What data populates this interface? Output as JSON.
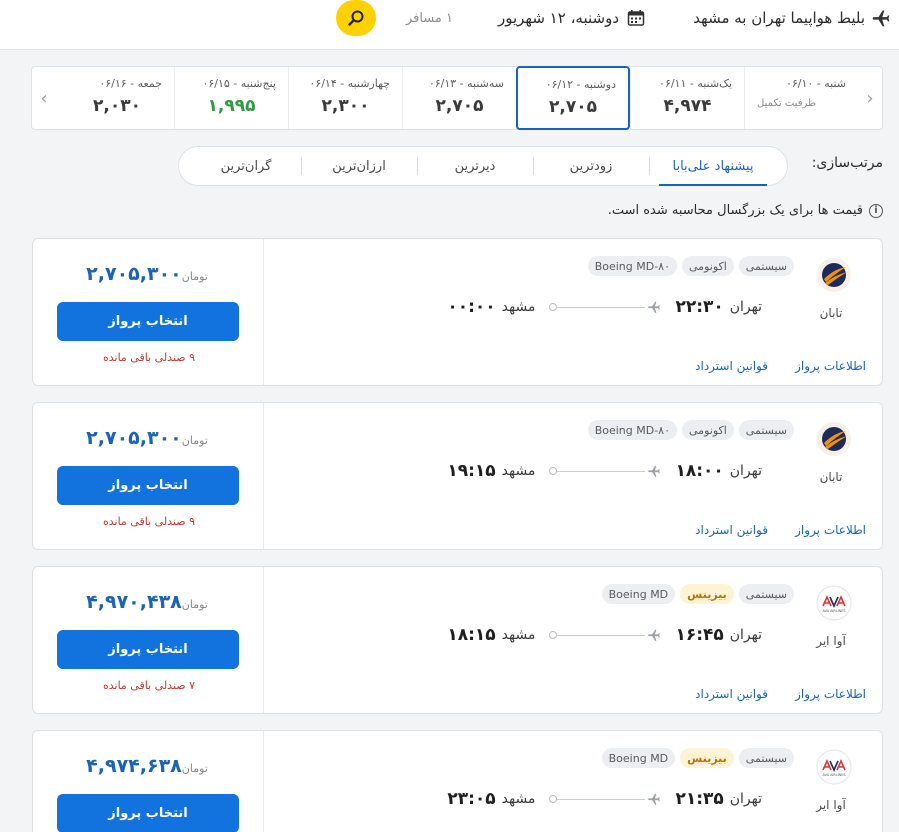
{
  "header": {
    "title": "بلیط هواپیما تهران به مشهد",
    "date": "دوشنبه، ۱۲ شهریور",
    "passengers": "۱ مسافر",
    "icons": {
      "plane": "plane-icon",
      "calendar": "calendar-icon",
      "search": "search-icon"
    },
    "accent": "#fdd000"
  },
  "date_strip": {
    "days": [
      {
        "label": "شنبه - ۰۶/۱۰",
        "price": "",
        "note": "ظرفیت تکمیل"
      },
      {
        "label": "یک‌شنبه - ۰۶/۱۱",
        "price": "۴,۹۷۴",
        "note": ""
      },
      {
        "label": "دوشنبه - ۰۶/۱۲",
        "price": "۲,۷۰۵",
        "note": "",
        "active": true
      },
      {
        "label": "سه‌شنبه - ۰۶/۱۳",
        "price": "۲,۷۰۵",
        "note": ""
      },
      {
        "label": "چهارشنبه - ۰۶/۱۴",
        "price": "۲,۳۰۰",
        "note": ""
      },
      {
        "label": "پنج‌شنبه - ۰۶/۱۵",
        "price": "۱,۹۹۵",
        "note": "",
        "green": true
      },
      {
        "label": "جمعه - ۰۶/۱۶",
        "price": "۲,۰۳۰",
        "note": ""
      }
    ]
  },
  "sort": {
    "label": "مرتب‌سازی:",
    "options": [
      "پیشنهاد علی‌بابا",
      "زودترین",
      "دیرترین",
      "ارزان‌ترین",
      "گران‌ترین"
    ],
    "active_index": 0
  },
  "price_note": "قیمت ها برای یک بزرگسال محاسبه شده است.",
  "flights": [
    {
      "airline": "تابان",
      "logo": "taban-logo",
      "chips": [
        "سیستمی",
        "اکونومی",
        "Boeing MD-۸۰"
      ],
      "origin": "تهران",
      "dep": "۲۲:۳۰",
      "dest": "مشهد",
      "arr": "۰۰:۰۰",
      "price": "۲,۷۰۵,۳۰۰",
      "currency": "تومان",
      "button": "انتخاب پرواز",
      "seats": "۹ صندلی باقی مانده",
      "link_info": "اطلاعات پرواز",
      "link_refund": "قوانین استرداد"
    },
    {
      "airline": "تابان",
      "logo": "taban-logo",
      "chips": [
        "سیستمی",
        "اکونومی",
        "Boeing MD-۸۰"
      ],
      "origin": "تهران",
      "dep": "۱۸:۰۰",
      "dest": "مشهد",
      "arr": "۱۹:۱۵",
      "price": "۲,۷۰۵,۳۰۰",
      "currency": "تومان",
      "button": "انتخاب پرواز",
      "seats": "۹ صندلی باقی مانده",
      "link_info": "اطلاعات پرواز",
      "link_refund": "قوانین استرداد"
    },
    {
      "airline": "آوا ایر",
      "logo": "ava-air-logo",
      "chips": [
        "سیستمی",
        "بیزینس",
        "Boeing MD"
      ],
      "origin": "تهران",
      "dep": "۱۶:۴۵",
      "dest": "مشهد",
      "arr": "۱۸:۱۵",
      "price": "۴,۹۷۰,۴۳۸",
      "currency": "تومان",
      "button": "انتخاب پرواز",
      "seats": "۷ صندلی باقی مانده",
      "link_info": "اطلاعات پرواز",
      "link_refund": "قوانین استرداد"
    },
    {
      "airline": "آوا ایر",
      "logo": "ava-air-logo",
      "chips": [
        "سیستمی",
        "بیزینس",
        "Boeing MD"
      ],
      "origin": "تهران",
      "dep": "۲۱:۳۵",
      "dest": "مشهد",
      "arr": "۲۳:۰۵",
      "price": "۴,۹۷۴,۶۳۸",
      "currency": "تومان",
      "button": "انتخاب پرواز",
      "seats": "",
      "link_info": "",
      "link_refund": ""
    }
  ],
  "logo_text": {
    "ava": "AVA AIRLINES"
  },
  "colors": {
    "primary": "#1b62b8",
    "button": "#1273de",
    "green": "#2d9c40",
    "seat_red": "#c0392b",
    "business_chip": "#b0790a"
  }
}
